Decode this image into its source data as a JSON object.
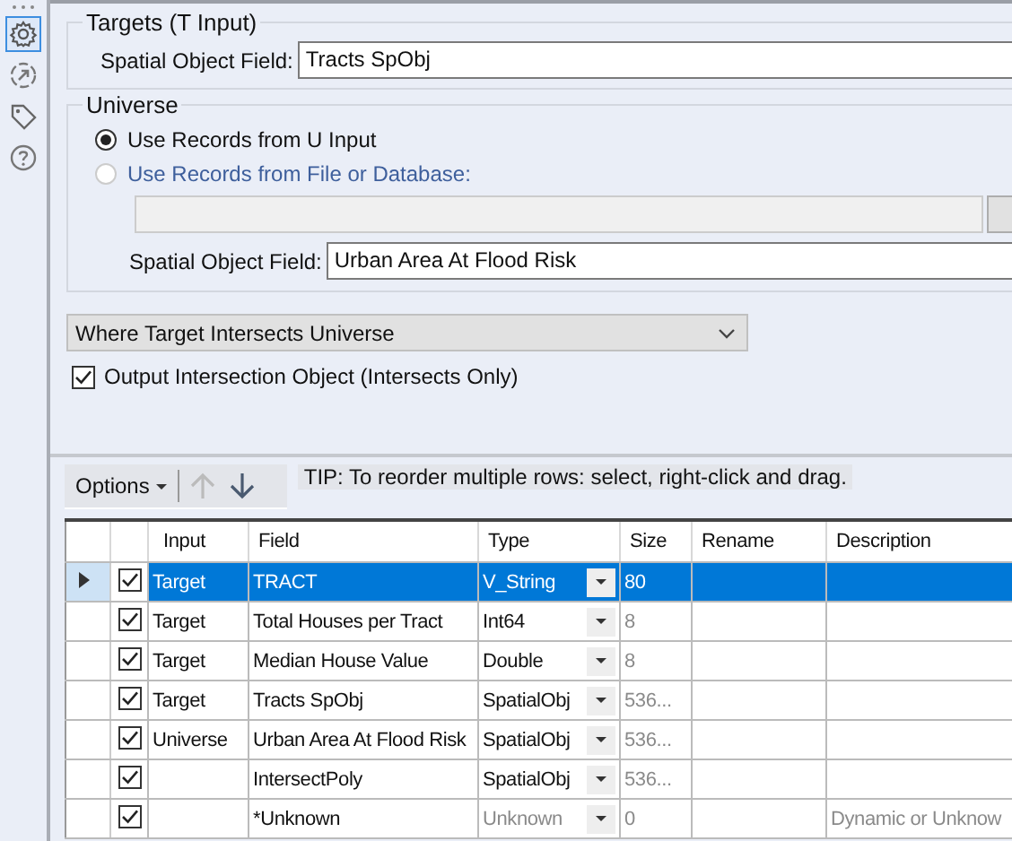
{
  "sidebar": {
    "items": [
      {
        "selected": true
      },
      {
        "selected": false
      },
      {
        "selected": false
      },
      {
        "selected": false
      }
    ]
  },
  "targets": {
    "title": "Targets (T Input)",
    "field_label": "Spatial Object Field:",
    "field_value": "Tracts SpObj"
  },
  "universe": {
    "title": "Universe",
    "options": [
      {
        "label": "Use Records from U Input",
        "selected": true,
        "disabled": false
      },
      {
        "label": "Use Records from File or Database:",
        "selected": false,
        "disabled": true
      }
    ],
    "field_label": "Spatial Object Field:",
    "field_value": "Urban Area At Flood Risk"
  },
  "mode_dropdown": {
    "value": "Where Target Intersects Universe"
  },
  "output_checkbox": {
    "label": "Output Intersection Object (Intersects Only)",
    "checked": true
  },
  "toolbar": {
    "options_label": "Options",
    "tip": "TIP: To reorder multiple rows: select, right-click and drag."
  },
  "table": {
    "columns": [
      "Input",
      "Field",
      "Type",
      "Size",
      "Rename",
      "Description"
    ],
    "rows": [
      {
        "selected": true,
        "checked": true,
        "input": "Target",
        "field": "TRACT",
        "type": "V_String",
        "type_disabled": false,
        "size": "80",
        "description": ""
      },
      {
        "selected": false,
        "checked": true,
        "input": "Target",
        "field": "Total Houses per Tract",
        "type": "Int64",
        "type_disabled": false,
        "size": "8",
        "description": ""
      },
      {
        "selected": false,
        "checked": true,
        "input": "Target",
        "field": "Median House Value",
        "type": "Double",
        "type_disabled": false,
        "size": "8",
        "description": ""
      },
      {
        "selected": false,
        "checked": true,
        "input": "Target",
        "field": "Tracts SpObj",
        "type": "SpatialObj",
        "type_disabled": false,
        "size": "536...",
        "description": ""
      },
      {
        "selected": false,
        "checked": true,
        "input": "Universe",
        "field": "Urban Area At Flood Risk",
        "type": "SpatialObj",
        "type_disabled": false,
        "size": "536...",
        "description": ""
      },
      {
        "selected": false,
        "checked": true,
        "input": "",
        "field": "IntersectPoly",
        "type": "SpatialObj",
        "type_disabled": false,
        "size": "536...",
        "description": ""
      },
      {
        "selected": false,
        "checked": true,
        "input": "",
        "field": "*Unknown",
        "type": "Unknown",
        "type_disabled": true,
        "size": "0",
        "description": "Dynamic or Unknow"
      }
    ]
  }
}
